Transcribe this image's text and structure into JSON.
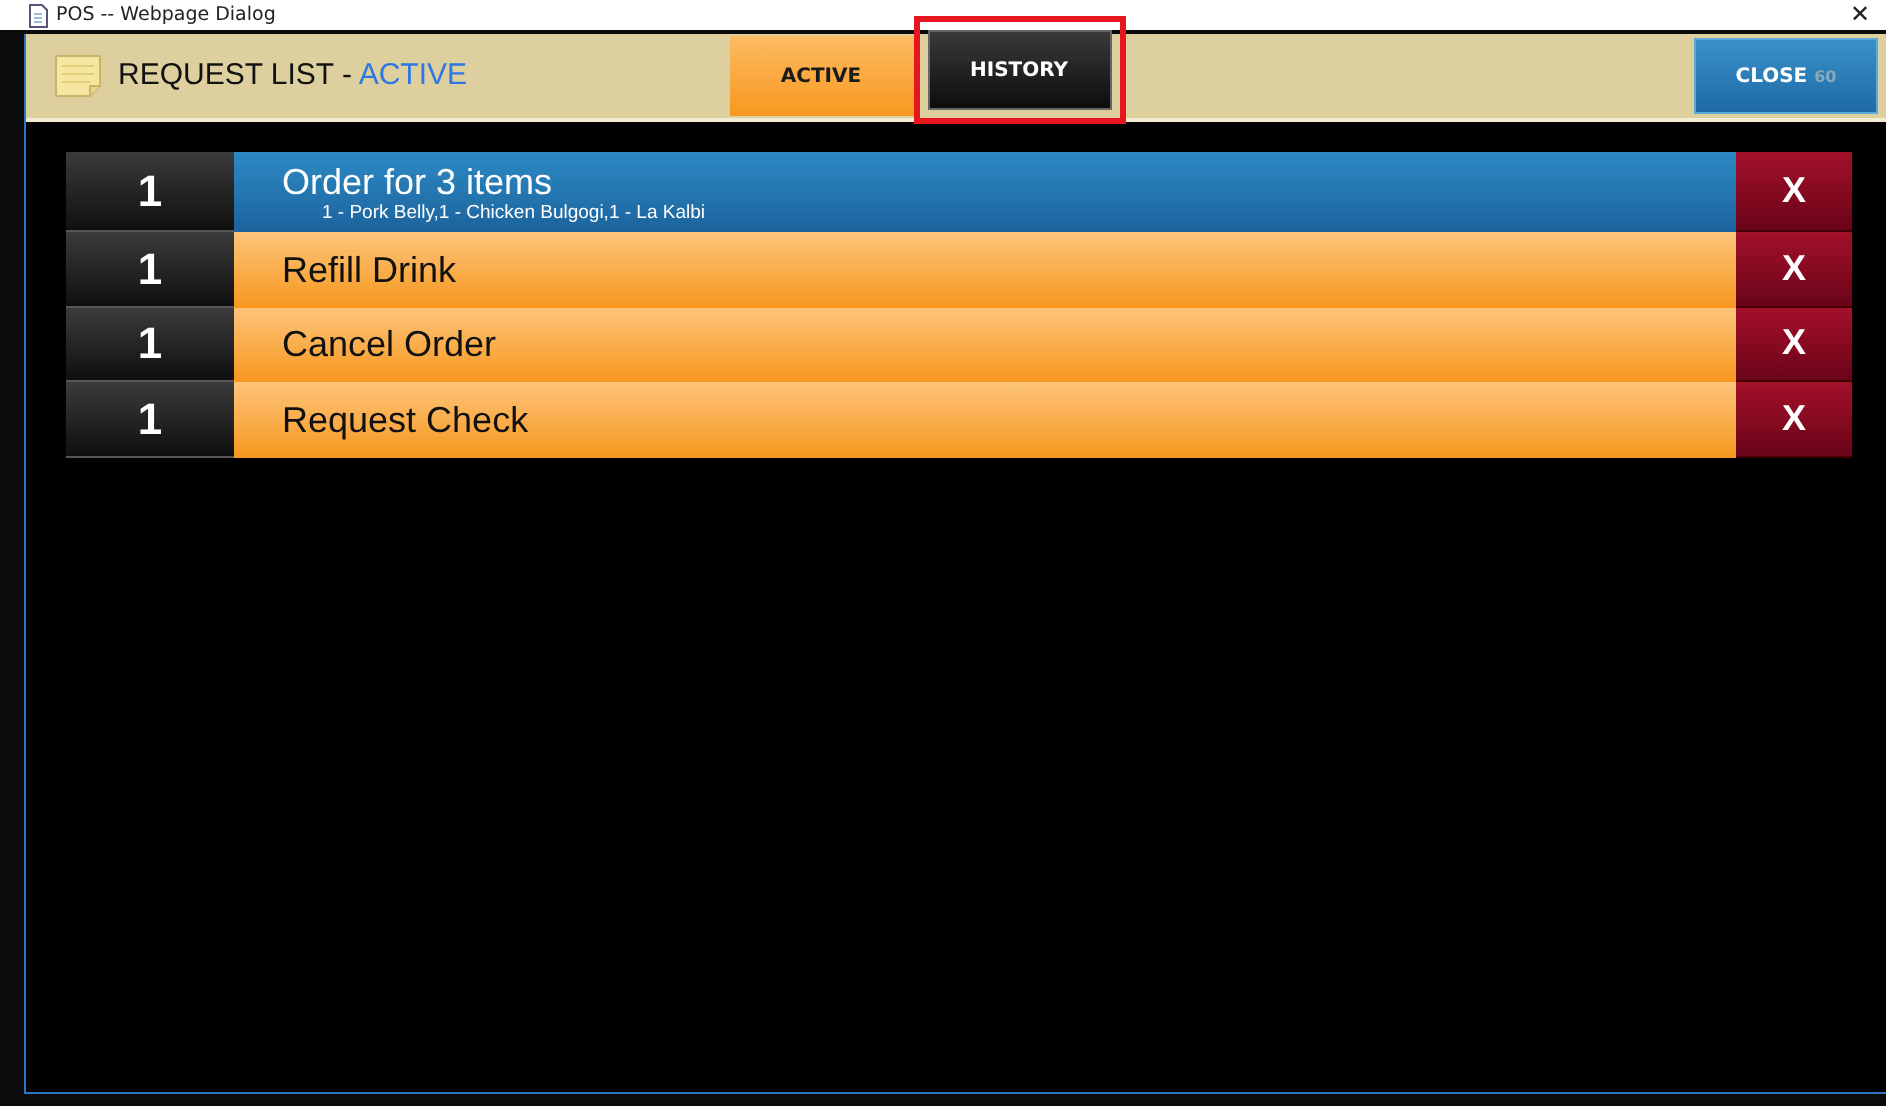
{
  "window": {
    "title": "POS -- Webpage Dialog",
    "close": "✕"
  },
  "header": {
    "title": "REQUEST LIST - ",
    "status": "ACTIVE"
  },
  "tabs": [
    {
      "label": "ACTIVE",
      "selected": true
    },
    {
      "label": "HISTORY",
      "selected": false
    }
  ],
  "close_button": {
    "label": "CLOSE",
    "countdown": "60"
  },
  "requests": [
    {
      "kind": "order",
      "count": "1",
      "title": "Order for 3 items",
      "detail": "1 - Pork Belly,1 - Chicken Bulgogi,1 - La Kalbi",
      "remove": "X"
    },
    {
      "kind": "request",
      "count": "1",
      "title": "Refill Drink",
      "remove": "X"
    },
    {
      "kind": "request",
      "count": "1",
      "title": "Cancel Order",
      "remove": "X"
    },
    {
      "kind": "request",
      "count": "1",
      "title": "Request Check",
      "remove": "X"
    }
  ]
}
